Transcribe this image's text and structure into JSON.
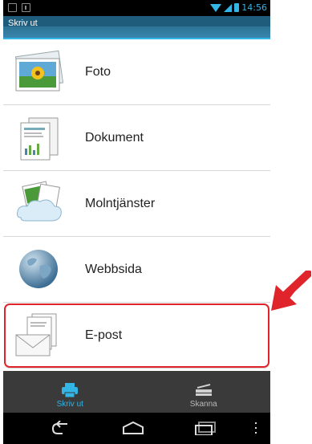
{
  "statusbar": {
    "time": "14:56"
  },
  "titlebar": {
    "title": "Skriv ut"
  },
  "list": {
    "items": [
      {
        "label": "Foto",
        "icon": "photo-icon"
      },
      {
        "label": "Dokument",
        "icon": "document-icon"
      },
      {
        "label": "Molntjänster",
        "icon": "cloud-services-icon"
      },
      {
        "label": "Webbsida",
        "icon": "globe-icon"
      },
      {
        "label": "E-post",
        "icon": "email-icon"
      }
    ]
  },
  "tabs": [
    {
      "label": "Skriv ut",
      "icon": "printer-icon",
      "active": true
    },
    {
      "label": "Skanna",
      "icon": "scanner-icon",
      "active": false
    }
  ],
  "colors": {
    "accent": "#33b5e5",
    "highlight": "#e0242b",
    "titlebar": "#1f5c7c"
  }
}
